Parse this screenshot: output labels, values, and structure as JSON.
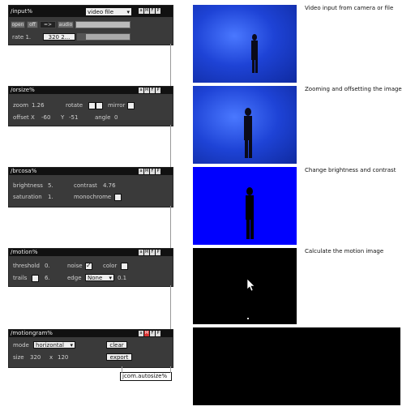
{
  "modules": {
    "input": {
      "title": "/input%",
      "source_menu": "video file",
      "open": "open",
      "off": "off",
      "arrow": "=>",
      "audio": "audio",
      "rate_label": "rate 1.",
      "size_value": "320 2..."
    },
    "orsize": {
      "title": "/orsize%",
      "zoom_label": "zoom",
      "zoom_value": "1.26",
      "rotate_label": "rotate",
      "mirror_label": "mirror",
      "offset_label": "offset X",
      "offset_x": "-60",
      "y_label": "Y",
      "offset_y": "-51",
      "angle_label": "angle",
      "angle_value": "0"
    },
    "brcosa": {
      "title": "/brcosa%",
      "brightness_label": "brightness",
      "brightness_value": "5.",
      "contrast_label": "contrast",
      "contrast_value": "4.76",
      "saturation_label": "saturation",
      "saturation_value": "1.",
      "monochrome_label": "monochrome"
    },
    "motion": {
      "title": "/motion%",
      "threshold_label": "threshold",
      "threshold_value": "0.",
      "noise_label": "noise",
      "color_label": "color",
      "trails_label": "trails",
      "trails_value": "6.",
      "edge_label": "edge",
      "edge_value": "None",
      "edge_amount": "0.1"
    },
    "motiongram": {
      "title": "/motiongram%",
      "mode_label": "mode",
      "mode_value": "horizontal",
      "clear": "clear",
      "size_label": "size",
      "size_w": "320",
      "size_x": "x",
      "size_h": "120",
      "export": "export"
    },
    "jcom": {
      "label": "jcom.autosize%"
    }
  },
  "amfp": [
    "a",
    "M",
    "F",
    "P"
  ],
  "captions": {
    "input": "Video input from camera or file",
    "orsize": "Zooming and offsetting the image",
    "brcosa": "Change brightness and contrast",
    "motion": "Calculate the motion image"
  },
  "colors": {
    "module_bg": "#3a3a3a",
    "titlebar": "#111111",
    "video_blue": "#1f3fd0",
    "video_bright_blue": "#0000ff",
    "motion_bg": "#000000",
    "amfp_active": "#dd3333"
  }
}
